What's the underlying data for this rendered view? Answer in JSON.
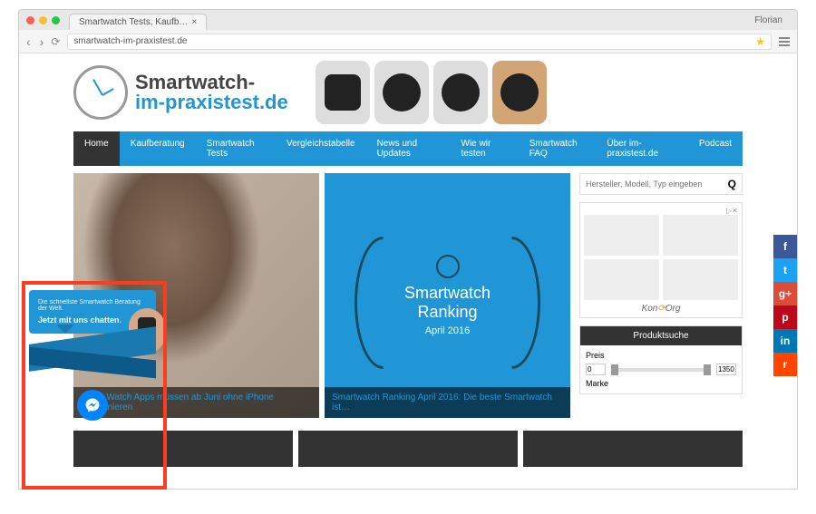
{
  "browser": {
    "tab_title": "Smartwatch Tests, Kaufb…",
    "user": "Florian",
    "url": "smartwatch-im-praxistest.de"
  },
  "site": {
    "logo_line1": "Smartwatch-",
    "logo_line2": "im-praxistest.de"
  },
  "nav": [
    {
      "label": "Home",
      "active": true
    },
    {
      "label": "Kaufberatung",
      "active": false
    },
    {
      "label": "Smartwatch Tests",
      "active": false
    },
    {
      "label": "Vergleichstabelle",
      "active": false
    },
    {
      "label": "News und Updates",
      "active": false
    },
    {
      "label": "Wie wir testen",
      "active": false
    },
    {
      "label": "Smartwatch FAQ",
      "active": false
    },
    {
      "label": "Über im-praxistest.de",
      "active": false
    },
    {
      "label": "Podcast",
      "active": false
    }
  ],
  "features": {
    "card1_caption": "Apple Watch Apps müssen ab Juni ohne iPhone funktionieren",
    "card2_title_l1": "Smartwatch",
    "card2_title_l2": "Ranking",
    "card2_date": "April 2016",
    "card2_caption": "Smartwatch Ranking April 2016: Die beste Smartwatch ist…"
  },
  "sidebar": {
    "search_placeholder": "Hersteller, Modell, Typ eingeben",
    "ad_label": "",
    "ad_brand": "Kon Org",
    "prod_title": "Produktsuche",
    "price_label": "Preis",
    "price_min": "0",
    "price_max": "1350",
    "brand_label": "Marke"
  },
  "chat": {
    "tagline": "Die schnellste Smartwatch Beratung der Welt.",
    "cta": "Jetzt mit uns chatten."
  },
  "social": [
    "f",
    "t",
    "g+",
    "p",
    "in",
    "r"
  ]
}
